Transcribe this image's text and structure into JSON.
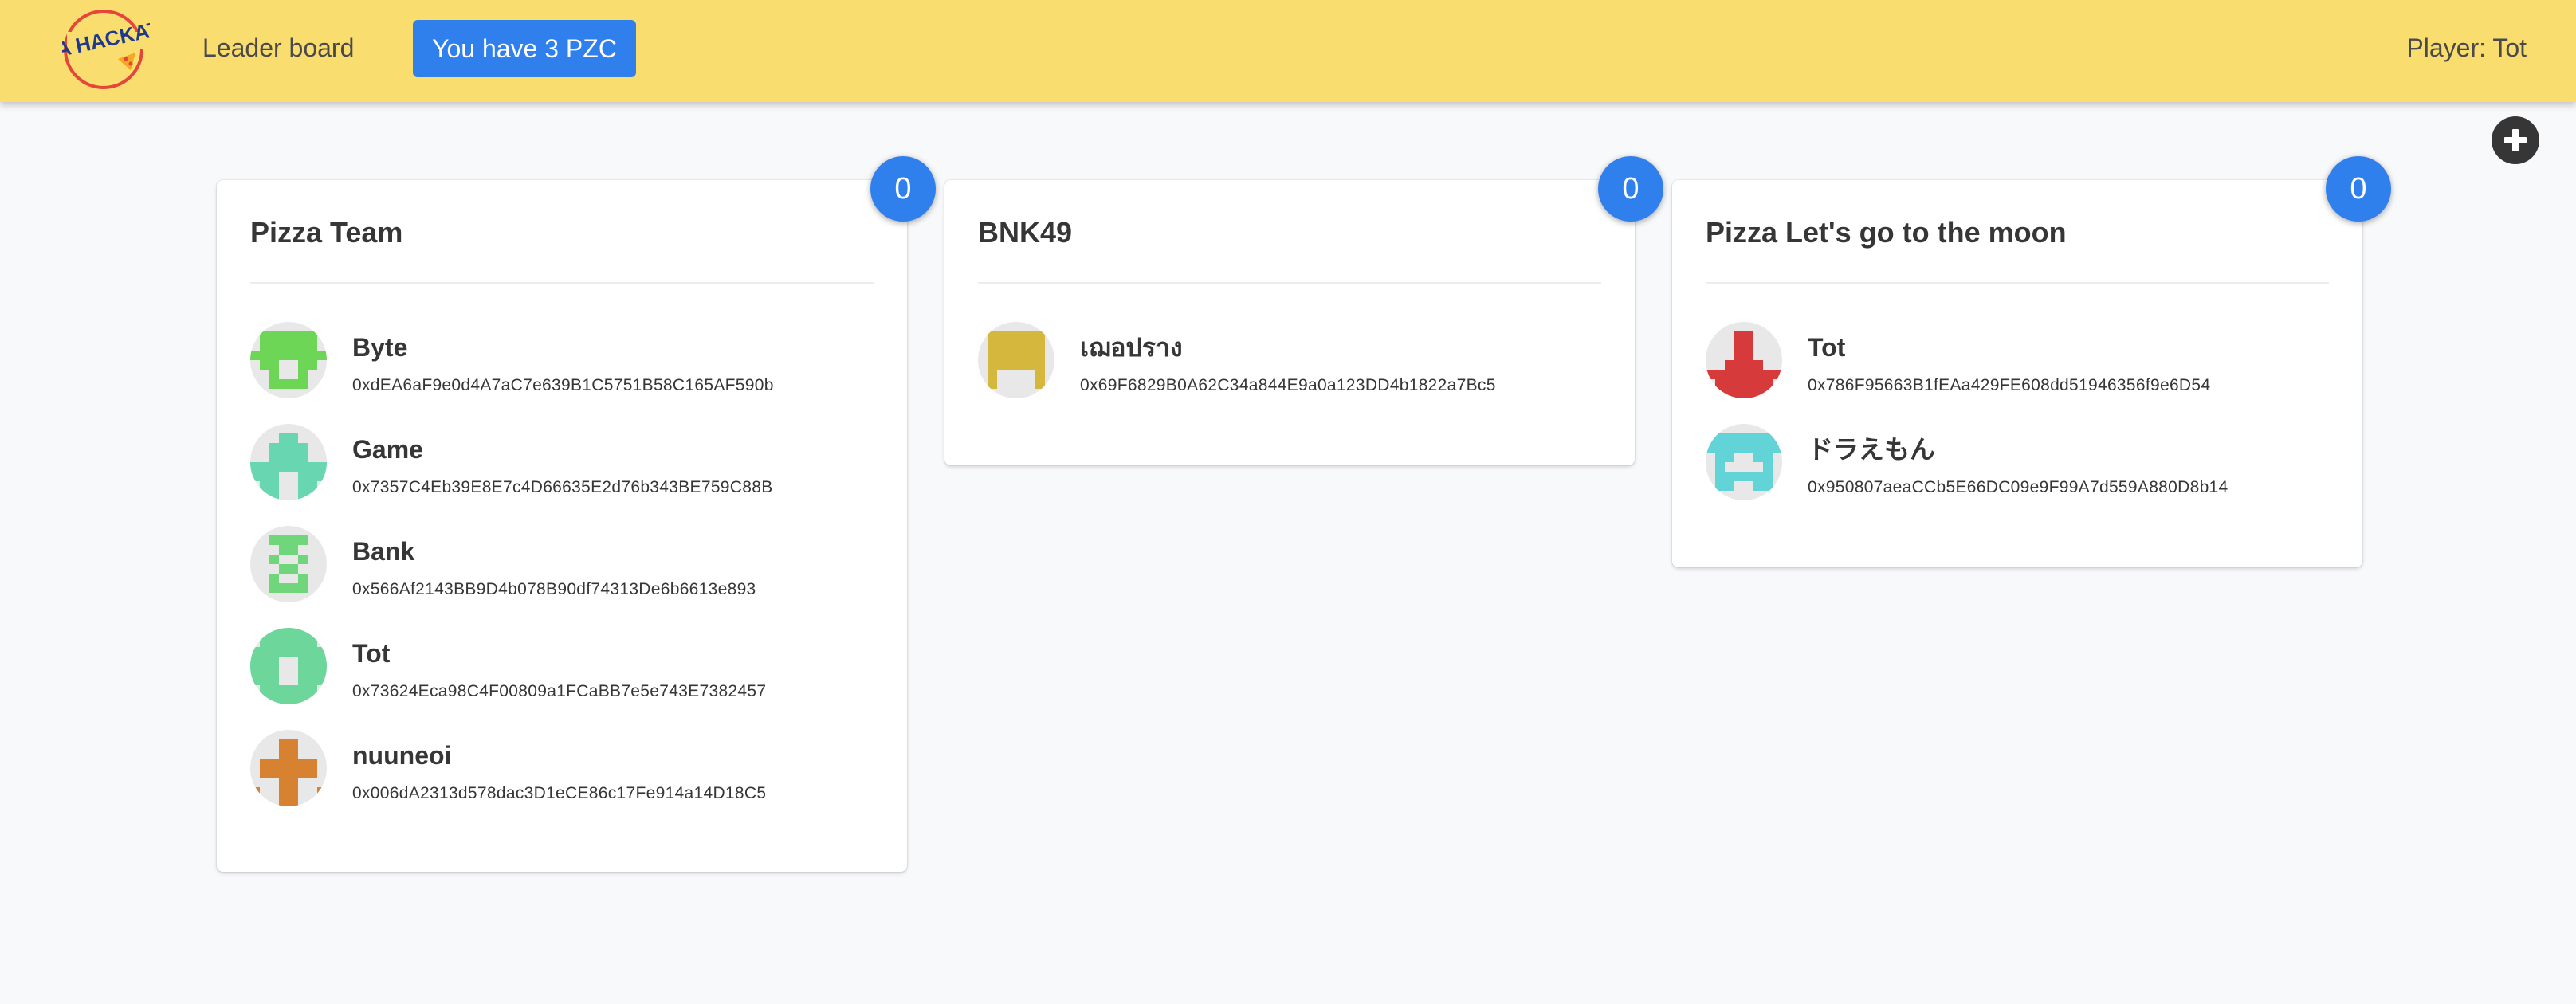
{
  "navbar": {
    "logo_text": "PIZZA HACKATHON",
    "leaderboard_label": "Leader board",
    "pzc_button_label": "You have 3 PZC",
    "player_label": "Player: Tot"
  },
  "colors": {
    "navbar_bg": "#fadd6f",
    "primary": "#2f80ed",
    "page_bg": "#f8f9fb",
    "add_button": "#363636"
  },
  "add_team_icon": "plus-circle-icon",
  "teams": [
    {
      "name": "Pizza Team",
      "score": "0",
      "members": [
        {
          "name": "Byte",
          "address": "0xdEA6aF9e0d4A7aC7e639B1C5751B58C165AF590b",
          "avatar_color": "#6ed657"
        },
        {
          "name": "Game",
          "address": "0x7357C4Eb39E8E7c4D66635E2d76b343BE759C88B",
          "avatar_color": "#68d6b0"
        },
        {
          "name": "Bank",
          "address": "0x566Af2143BB9D4b078B90df74313De6b6613e893",
          "avatar_color": "#6fd67c"
        },
        {
          "name": "Tot",
          "address": "0x73624Eca98C4F00809a1FCaBB7e5e743E7382457",
          "avatar_color": "#6cd69b"
        },
        {
          "name": "nuuneoi",
          "address": "0x006dA2313d578dac3D1eCE86c17Fe914a14D18C5",
          "avatar_color": "#d68230"
        }
      ]
    },
    {
      "name": "BNK49",
      "score": "0",
      "members": [
        {
          "name": "เฌอปราง",
          "address": "0x69F6829B0A62C34a844E9a0a123DD4b1822a7Bc5",
          "avatar_color": "#d6b73d"
        }
      ]
    },
    {
      "name": "Pizza Let's go to the moon",
      "score": "0",
      "members": [
        {
          "name": "Tot",
          "address": "0x786F95663B1fEAa429FE608dd51946356f9e6D54",
          "avatar_color": "#d63a3a"
        },
        {
          "name": "ドラえもん",
          "address": "0x950807aeaCCb5E66DC09e9F99A7d559A880D8b14",
          "avatar_color": "#62d3d6"
        }
      ]
    }
  ]
}
